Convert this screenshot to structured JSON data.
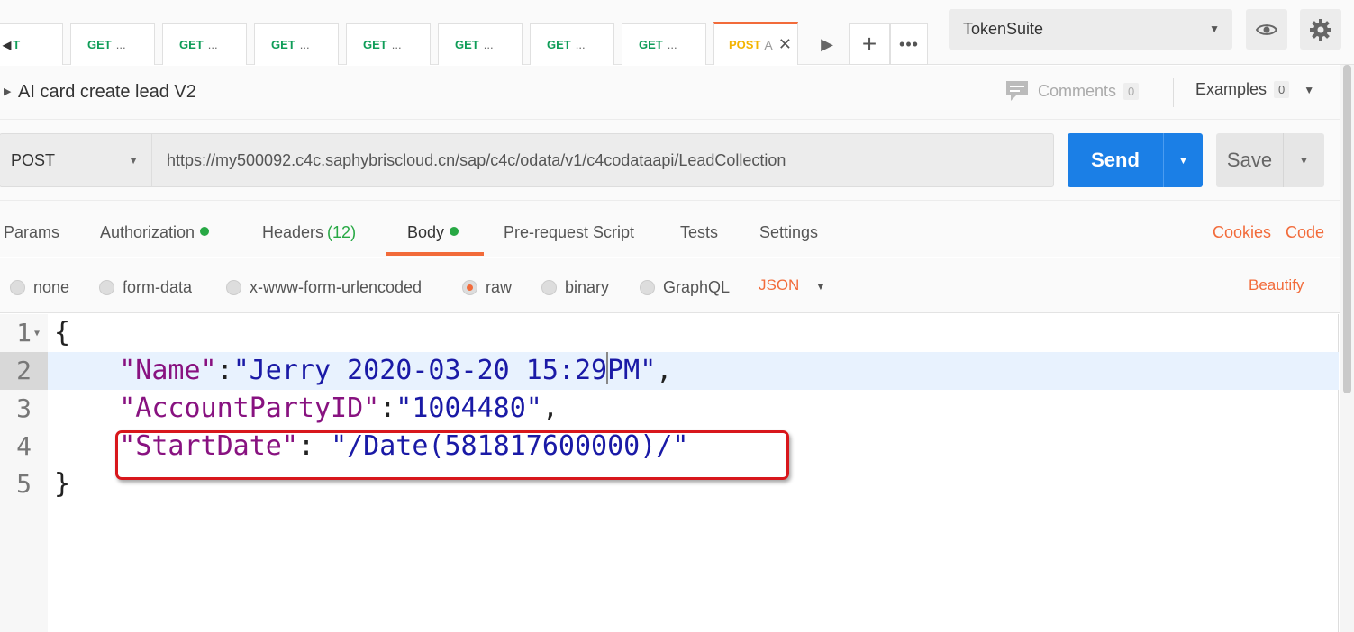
{
  "tabs": [
    {
      "method": "T",
      "label": ""
    },
    {
      "method": "GET",
      "label": "..."
    },
    {
      "method": "GET",
      "label": "..."
    },
    {
      "method": "GET",
      "label": "..."
    },
    {
      "method": "GET",
      "label": "..."
    },
    {
      "method": "GET",
      "label": "..."
    },
    {
      "method": "GET",
      "label": "..."
    },
    {
      "method": "GET",
      "label": "..."
    },
    {
      "method": "POST",
      "label": "A"
    }
  ],
  "toolbar": {
    "add_tab": "+",
    "more_tabs": "•••",
    "environment": "TokenSuite"
  },
  "request": {
    "name": "AI card create lead V2",
    "comments_label": "Comments",
    "comments_count": "0",
    "examples_label": "Examples",
    "examples_count": "0",
    "method": "POST",
    "url": "https://my500092.c4c.saphybriscloud.cn/sap/c4c/odata/v1/c4codataapi/LeadCollection",
    "send_label": "Send",
    "save_label": "Save"
  },
  "request_tabs": {
    "params": "Params",
    "authorization": "Authorization",
    "headers": "Headers",
    "headers_count": "(12)",
    "body": "Body",
    "pre_request": "Pre-request Script",
    "tests": "Tests",
    "settings": "Settings",
    "cookies": "Cookies",
    "code": "Code"
  },
  "body_types": {
    "none": "none",
    "form_data": "form-data",
    "urlencoded": "x-www-form-urlencoded",
    "raw": "raw",
    "binary": "binary",
    "graphql": "GraphQL",
    "selected": "raw",
    "language": "JSON",
    "beautify": "Beautify"
  },
  "editor": {
    "line_numbers": [
      "1",
      "2",
      "3",
      "4",
      "5"
    ],
    "line1": "{",
    "line2_key": "\"Name\"",
    "line2_sep": ":",
    "line2_val_a": "\"Jerry 2020-03-20 15:29",
    "line2_val_b": "PM\"",
    "line2_comma": ",",
    "line3_key": "\"AccountPartyID\"",
    "line3_sep": ":",
    "line3_val": "\"1004480\"",
    "line3_comma": ",",
    "line4_key": "\"StartDate\"",
    "line4_sep": ": ",
    "line4_val": "\"/Date(581817600000)/\"",
    "line5": "}"
  },
  "colors": {
    "accent": "#f26b3a",
    "send_blue": "#1b7fe6",
    "get_green": "#0f9d58",
    "post_yellow": "#f4b400",
    "json_key": "#881280",
    "json_string": "#1a1aa6",
    "annotation_red": "#d8171c"
  }
}
